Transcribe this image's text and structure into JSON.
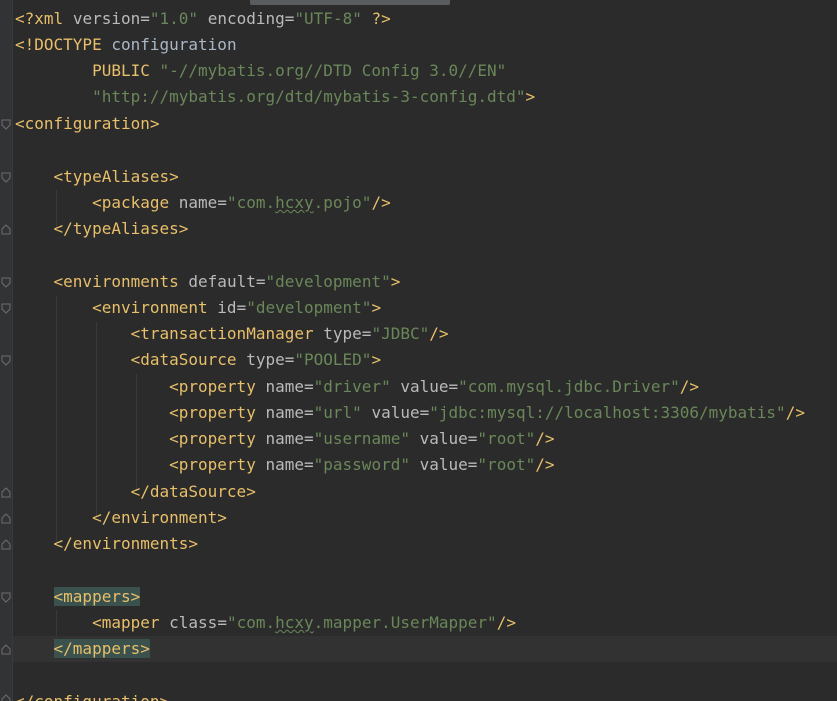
{
  "editor": {
    "language": "XML",
    "colors": {
      "background": "#2b2b2b",
      "tag": "#e8bf6a",
      "attribute": "#bababa",
      "value": "#6a8759",
      "text": "#a9b7c6",
      "bracket_match": "#3b514d"
    },
    "lines": {
      "l1": {
        "open": "<?xml",
        "a1": "version",
        "eq1": "=",
        "v1": "\"1.0\"",
        "a2": "encoding",
        "eq2": "=",
        "v2": "\"UTF-8\"",
        "close": "?>"
      },
      "l2": {
        "open": "<!DOCTYPE",
        "text": "configuration"
      },
      "l3": {
        "kw": "PUBLIC",
        "val": "\"-//mybatis.org//DTD Config 3.0//EN\""
      },
      "l4": {
        "val": "\"http://mybatis.org/dtd/mybatis-3-config.dtd\"",
        "close": ">"
      },
      "l5": {
        "tag": "<configuration>"
      },
      "l7": {
        "tag": "<typeAliases>"
      },
      "l8": {
        "open": "<package",
        "a1": "name",
        "eq1": "=",
        "q1": "\"com.",
        "typo": "hcxy",
        "q2": ".pojo\"",
        "close": "/>"
      },
      "l9": {
        "tag": "</typeAliases>"
      },
      "l11": {
        "open": "<environments",
        "a1": "default",
        "eq1": "=",
        "v1": "\"development\"",
        "close": ">"
      },
      "l12": {
        "open": "<environment",
        "a1": "id",
        "eq1": "=",
        "v1": "\"development\"",
        "close": ">"
      },
      "l13": {
        "open": "<transactionManager",
        "a1": "type",
        "eq1": "=",
        "v1": "\"JDBC\"",
        "close": "/>"
      },
      "l14": {
        "open": "<dataSource",
        "a1": "type",
        "eq1": "=",
        "v1": "\"POOLED\"",
        "close": ">"
      },
      "l15": {
        "open": "<property",
        "a1": "name",
        "eq1": "=",
        "v1": "\"driver\"",
        "a2": "value",
        "eq2": "=",
        "v2": "\"com.mysql.jdbc.Driver\"",
        "close": "/>"
      },
      "l16": {
        "open": "<property",
        "a1": "name",
        "eq1": "=",
        "v1": "\"url\"",
        "a2": "value",
        "eq2": "=",
        "v2": "\"jdbc:mysql://localhost:3306/mybatis\"",
        "close": "/>"
      },
      "l17": {
        "open": "<property",
        "a1": "name",
        "eq1": "=",
        "v1": "\"username\"",
        "a2": "value",
        "eq2": "=",
        "v2": "\"root\"",
        "close": "/>"
      },
      "l18": {
        "open": "<property",
        "a1": "name",
        "eq1": "=",
        "v1": "\"password\"",
        "a2": "value",
        "eq2": "=",
        "v2": "\"root\"",
        "close": "/>"
      },
      "l19": {
        "tag": "</dataSource>"
      },
      "l20": {
        "tag": "</environment>"
      },
      "l21": {
        "tag": "</environments>"
      },
      "l23": {
        "tag": "<mappers>"
      },
      "l24": {
        "open": "<mapper",
        "a1": "class",
        "eq1": "=",
        "q1": "\"com.",
        "typo": "hcxy",
        "q2": ".mapper.UserMapper\"",
        "close": "/>"
      },
      "l25": {
        "tag": "</mappers>"
      },
      "l27": {
        "tag": "</configuration>"
      }
    }
  }
}
